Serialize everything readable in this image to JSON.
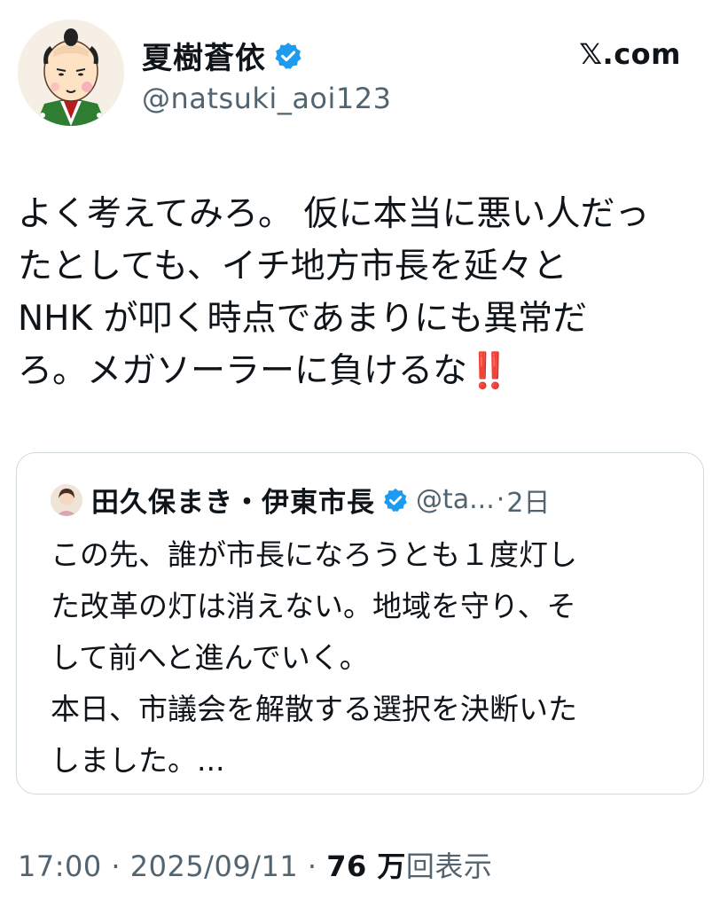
{
  "author": {
    "name": "夏樹蒼依",
    "handle": "@natsuki_aoi123",
    "verified": true
  },
  "site_label": "𝕏.com",
  "tweet": {
    "lines": [
      "よく考えてみろ。 仮に本当に悪い人だっ",
      "たとしても、イチ地方市長を延々と",
      "NHK が叩く時点であまりにも異常だ",
      "ろ。メガソーラーに負けるな"
    ],
    "emoji": "‼️"
  },
  "quote": {
    "name": "田久保まき・伊東市長",
    "handle": "@ta...",
    "separator": "·",
    "time": "2日",
    "lines": [
      "この先、誰が市長になろうとも１度灯し",
      "た改革の灯は消えない。地域を守り、そ",
      "して前へと進んでいく。",
      "本日、市議会を解散する選択を決断いた",
      "しました。..."
    ]
  },
  "footer": {
    "time": "17:00",
    "sep1": "·",
    "date": "2025/09/11",
    "sep2": "·",
    "views_num": "76 万",
    "views_label": "回表示"
  },
  "colors": {
    "verified_blue": "#1d9bf0",
    "muted_text": "#536471",
    "border": "#cfd9de"
  }
}
